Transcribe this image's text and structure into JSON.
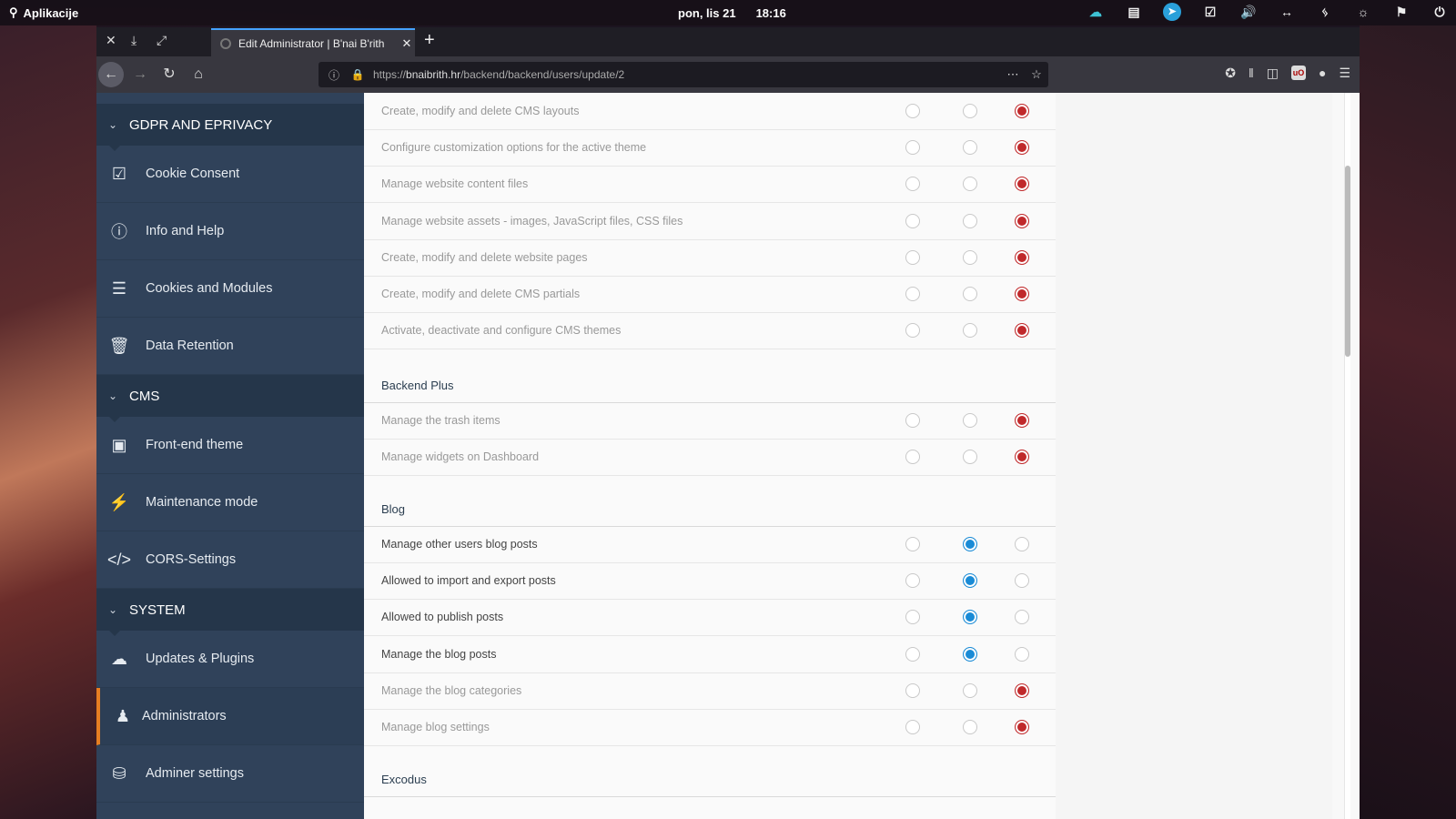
{
  "desktop": {
    "apps_label": "Aplikacije",
    "date": "pon, lis 21",
    "time": "18:16"
  },
  "browser": {
    "tab_title": "Edit Administrator | B'nai B'rith",
    "url_domain": "bnaibrith.hr",
    "url_prefix": "https://",
    "url_path": "/backend/backend/users/update/2"
  },
  "sidebar": {
    "sections": [
      {
        "label": "GDPR AND EPRIVACY"
      },
      {
        "label": "CMS"
      },
      {
        "label": "SYSTEM"
      }
    ],
    "items": [
      {
        "label": "Cookie Consent",
        "icon": "check-square-icon"
      },
      {
        "label": "Info and Help",
        "icon": "info-icon"
      },
      {
        "label": "Cookies and Modules",
        "icon": "list-icon"
      },
      {
        "label": "Data Retention",
        "icon": "trash-icon"
      },
      {
        "label": "Front-end theme",
        "icon": "image-icon"
      },
      {
        "label": "Maintenance mode",
        "icon": "plug-icon"
      },
      {
        "label": "CORS-Settings",
        "icon": "code-icon"
      },
      {
        "label": "Updates & Plugins",
        "icon": "cloud-download-icon"
      },
      {
        "label": "Administrators",
        "icon": "users-icon",
        "active": true
      },
      {
        "label": "Adminer settings",
        "icon": "database-icon"
      }
    ]
  },
  "permissions": {
    "cms_rows": [
      {
        "label": "Create, modify and delete CMS layouts",
        "value": "deny"
      },
      {
        "label": "Configure customization options for the active theme",
        "value": "deny"
      },
      {
        "label": "Manage website content files",
        "value": "deny"
      },
      {
        "label": "Manage website assets - images, JavaScript files, CSS files",
        "value": "deny"
      },
      {
        "label": "Create, modify and delete website pages",
        "value": "deny"
      },
      {
        "label": "Create, modify and delete CMS partials",
        "value": "deny"
      },
      {
        "label": "Activate, deactivate and configure CMS themes",
        "value": "deny"
      }
    ],
    "groups": [
      {
        "title": "Backend Plus"
      },
      {
        "title": "Blog"
      },
      {
        "title": "Excodus"
      }
    ],
    "backend_plus_rows": [
      {
        "label": "Manage the trash items",
        "value": "deny"
      },
      {
        "label": "Manage widgets on Dashboard",
        "value": "deny"
      }
    ],
    "blog_rows": [
      {
        "label": "Manage other users blog posts",
        "value": "allow"
      },
      {
        "label": "Allowed to import and export posts",
        "value": "allow"
      },
      {
        "label": "Allowed to publish posts",
        "value": "allow"
      },
      {
        "label": "Manage the blog posts",
        "value": "allow"
      },
      {
        "label": "Manage the blog categories",
        "value": "deny"
      },
      {
        "label": "Manage blog settings",
        "value": "deny"
      }
    ]
  },
  "colors": {
    "deny": "#c0292b",
    "allow": "#1a8bd6",
    "active_accent": "#e67e22",
    "sidebar_bg": "#30425a"
  }
}
